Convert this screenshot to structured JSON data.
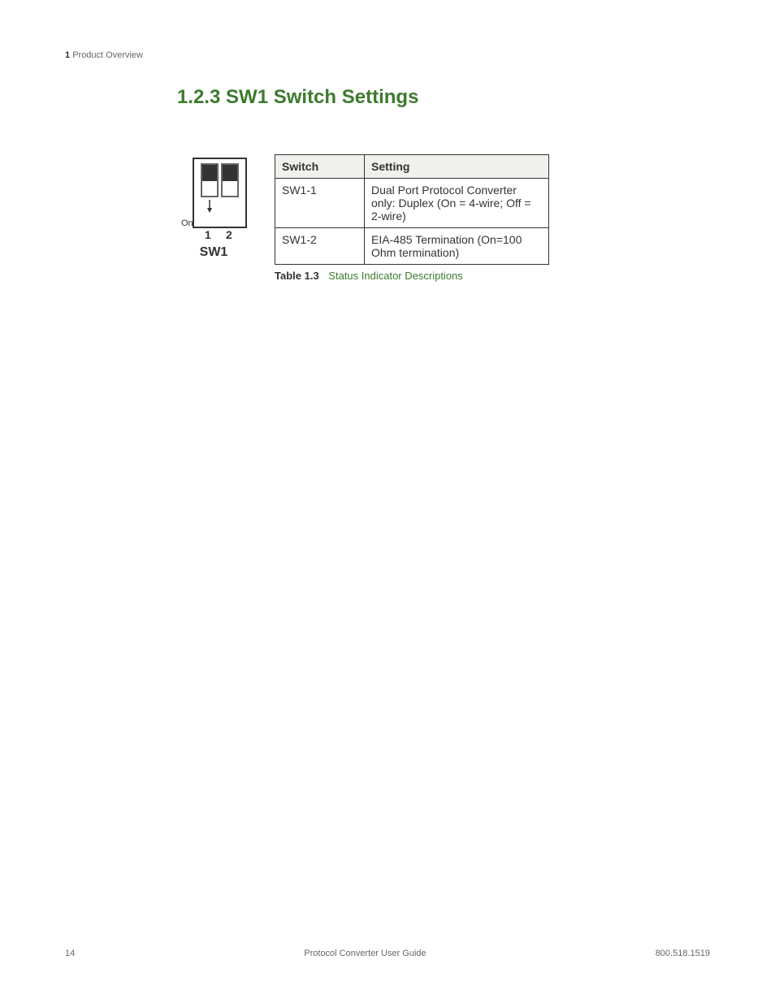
{
  "header": {
    "chapter_num": "1",
    "chapter_title": "Product Overview"
  },
  "heading": "1.2.3 SW1 Switch Settings",
  "figure": {
    "on_label": "On",
    "p1": "1",
    "p2": "2",
    "sw_label": "SW1"
  },
  "table": {
    "headers": {
      "c1": "Switch",
      "c2": "Setting"
    },
    "rows": [
      {
        "c1": "SW1-1",
        "c2": "Dual Port Protocol Converter only: Duplex (On = 4-wire; Off = 2-wire)"
      },
      {
        "c1": "SW1-2",
        "c2": "EIA-485 Termination (On=100 Ohm termination)"
      }
    ],
    "caption_num": "Table 1.3",
    "caption_desc": "Status Indicator Descriptions"
  },
  "footer": {
    "page": "14",
    "title": "Protocol Converter User Guide",
    "phone": "800.518.1519"
  }
}
